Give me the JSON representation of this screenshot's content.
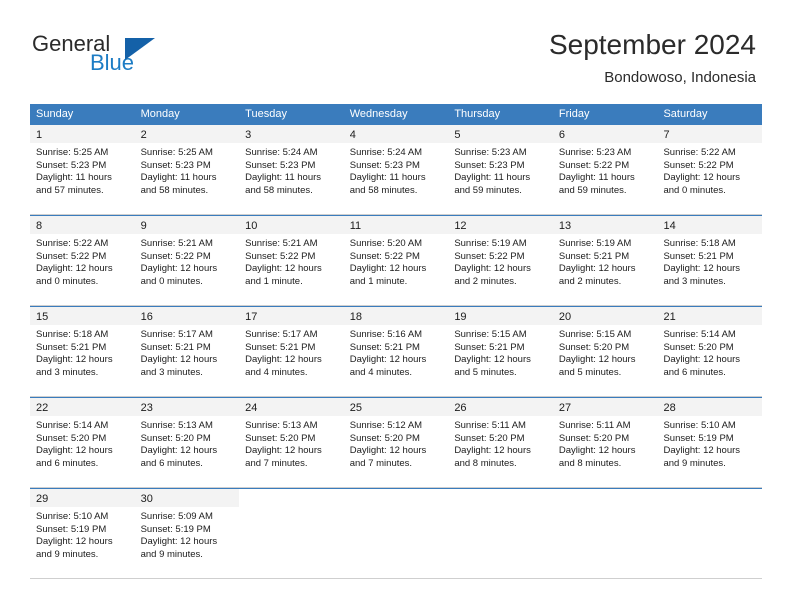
{
  "brand": {
    "name_part1": "General",
    "name_part2": "Blue",
    "logo_icon": "triangle-logo-icon"
  },
  "header": {
    "title": "September 2024",
    "subtitle": "Bondowoso, Indonesia"
  },
  "calendar": {
    "weekdays": [
      "Sunday",
      "Monday",
      "Tuesday",
      "Wednesday",
      "Thursday",
      "Friday",
      "Saturday"
    ],
    "header_bg": "#3a7cbd",
    "daynum_bg": "#f3f3f3",
    "weeks": [
      [
        {
          "day": "1",
          "sunrise": "Sunrise: 5:25 AM",
          "sunset": "Sunset: 5:23 PM",
          "daylight": "Daylight: 11 hours and 57 minutes."
        },
        {
          "day": "2",
          "sunrise": "Sunrise: 5:25 AM",
          "sunset": "Sunset: 5:23 PM",
          "daylight": "Daylight: 11 hours and 58 minutes."
        },
        {
          "day": "3",
          "sunrise": "Sunrise: 5:24 AM",
          "sunset": "Sunset: 5:23 PM",
          "daylight": "Daylight: 11 hours and 58 minutes."
        },
        {
          "day": "4",
          "sunrise": "Sunrise: 5:24 AM",
          "sunset": "Sunset: 5:23 PM",
          "daylight": "Daylight: 11 hours and 58 minutes."
        },
        {
          "day": "5",
          "sunrise": "Sunrise: 5:23 AM",
          "sunset": "Sunset: 5:23 PM",
          "daylight": "Daylight: 11 hours and 59 minutes."
        },
        {
          "day": "6",
          "sunrise": "Sunrise: 5:23 AM",
          "sunset": "Sunset: 5:22 PM",
          "daylight": "Daylight: 11 hours and 59 minutes."
        },
        {
          "day": "7",
          "sunrise": "Sunrise: 5:22 AM",
          "sunset": "Sunset: 5:22 PM",
          "daylight": "Daylight: 12 hours and 0 minutes."
        }
      ],
      [
        {
          "day": "8",
          "sunrise": "Sunrise: 5:22 AM",
          "sunset": "Sunset: 5:22 PM",
          "daylight": "Daylight: 12 hours and 0 minutes."
        },
        {
          "day": "9",
          "sunrise": "Sunrise: 5:21 AM",
          "sunset": "Sunset: 5:22 PM",
          "daylight": "Daylight: 12 hours and 0 minutes."
        },
        {
          "day": "10",
          "sunrise": "Sunrise: 5:21 AM",
          "sunset": "Sunset: 5:22 PM",
          "daylight": "Daylight: 12 hours and 1 minute."
        },
        {
          "day": "11",
          "sunrise": "Sunrise: 5:20 AM",
          "sunset": "Sunset: 5:22 PM",
          "daylight": "Daylight: 12 hours and 1 minute."
        },
        {
          "day": "12",
          "sunrise": "Sunrise: 5:19 AM",
          "sunset": "Sunset: 5:22 PM",
          "daylight": "Daylight: 12 hours and 2 minutes."
        },
        {
          "day": "13",
          "sunrise": "Sunrise: 5:19 AM",
          "sunset": "Sunset: 5:21 PM",
          "daylight": "Daylight: 12 hours and 2 minutes."
        },
        {
          "day": "14",
          "sunrise": "Sunrise: 5:18 AM",
          "sunset": "Sunset: 5:21 PM",
          "daylight": "Daylight: 12 hours and 3 minutes."
        }
      ],
      [
        {
          "day": "15",
          "sunrise": "Sunrise: 5:18 AM",
          "sunset": "Sunset: 5:21 PM",
          "daylight": "Daylight: 12 hours and 3 minutes."
        },
        {
          "day": "16",
          "sunrise": "Sunrise: 5:17 AM",
          "sunset": "Sunset: 5:21 PM",
          "daylight": "Daylight: 12 hours and 3 minutes."
        },
        {
          "day": "17",
          "sunrise": "Sunrise: 5:17 AM",
          "sunset": "Sunset: 5:21 PM",
          "daylight": "Daylight: 12 hours and 4 minutes."
        },
        {
          "day": "18",
          "sunrise": "Sunrise: 5:16 AM",
          "sunset": "Sunset: 5:21 PM",
          "daylight": "Daylight: 12 hours and 4 minutes."
        },
        {
          "day": "19",
          "sunrise": "Sunrise: 5:15 AM",
          "sunset": "Sunset: 5:21 PM",
          "daylight": "Daylight: 12 hours and 5 minutes."
        },
        {
          "day": "20",
          "sunrise": "Sunrise: 5:15 AM",
          "sunset": "Sunset: 5:20 PM",
          "daylight": "Daylight: 12 hours and 5 minutes."
        },
        {
          "day": "21",
          "sunrise": "Sunrise: 5:14 AM",
          "sunset": "Sunset: 5:20 PM",
          "daylight": "Daylight: 12 hours and 6 minutes."
        }
      ],
      [
        {
          "day": "22",
          "sunrise": "Sunrise: 5:14 AM",
          "sunset": "Sunset: 5:20 PM",
          "daylight": "Daylight: 12 hours and 6 minutes."
        },
        {
          "day": "23",
          "sunrise": "Sunrise: 5:13 AM",
          "sunset": "Sunset: 5:20 PM",
          "daylight": "Daylight: 12 hours and 6 minutes."
        },
        {
          "day": "24",
          "sunrise": "Sunrise: 5:13 AM",
          "sunset": "Sunset: 5:20 PM",
          "daylight": "Daylight: 12 hours and 7 minutes."
        },
        {
          "day": "25",
          "sunrise": "Sunrise: 5:12 AM",
          "sunset": "Sunset: 5:20 PM",
          "daylight": "Daylight: 12 hours and 7 minutes."
        },
        {
          "day": "26",
          "sunrise": "Sunrise: 5:11 AM",
          "sunset": "Sunset: 5:20 PM",
          "daylight": "Daylight: 12 hours and 8 minutes."
        },
        {
          "day": "27",
          "sunrise": "Sunrise: 5:11 AM",
          "sunset": "Sunset: 5:20 PM",
          "daylight": "Daylight: 12 hours and 8 minutes."
        },
        {
          "day": "28",
          "sunrise": "Sunrise: 5:10 AM",
          "sunset": "Sunset: 5:19 PM",
          "daylight": "Daylight: 12 hours and 9 minutes."
        }
      ],
      [
        {
          "day": "29",
          "sunrise": "Sunrise: 5:10 AM",
          "sunset": "Sunset: 5:19 PM",
          "daylight": "Daylight: 12 hours and 9 minutes."
        },
        {
          "day": "30",
          "sunrise": "Sunrise: 5:09 AM",
          "sunset": "Sunset: 5:19 PM",
          "daylight": "Daylight: 12 hours and 9 minutes."
        },
        {
          "day": "",
          "sunrise": "",
          "sunset": "",
          "daylight": ""
        },
        {
          "day": "",
          "sunrise": "",
          "sunset": "",
          "daylight": ""
        },
        {
          "day": "",
          "sunrise": "",
          "sunset": "",
          "daylight": ""
        },
        {
          "day": "",
          "sunrise": "",
          "sunset": "",
          "daylight": ""
        },
        {
          "day": "",
          "sunrise": "",
          "sunset": "",
          "daylight": ""
        }
      ]
    ]
  }
}
